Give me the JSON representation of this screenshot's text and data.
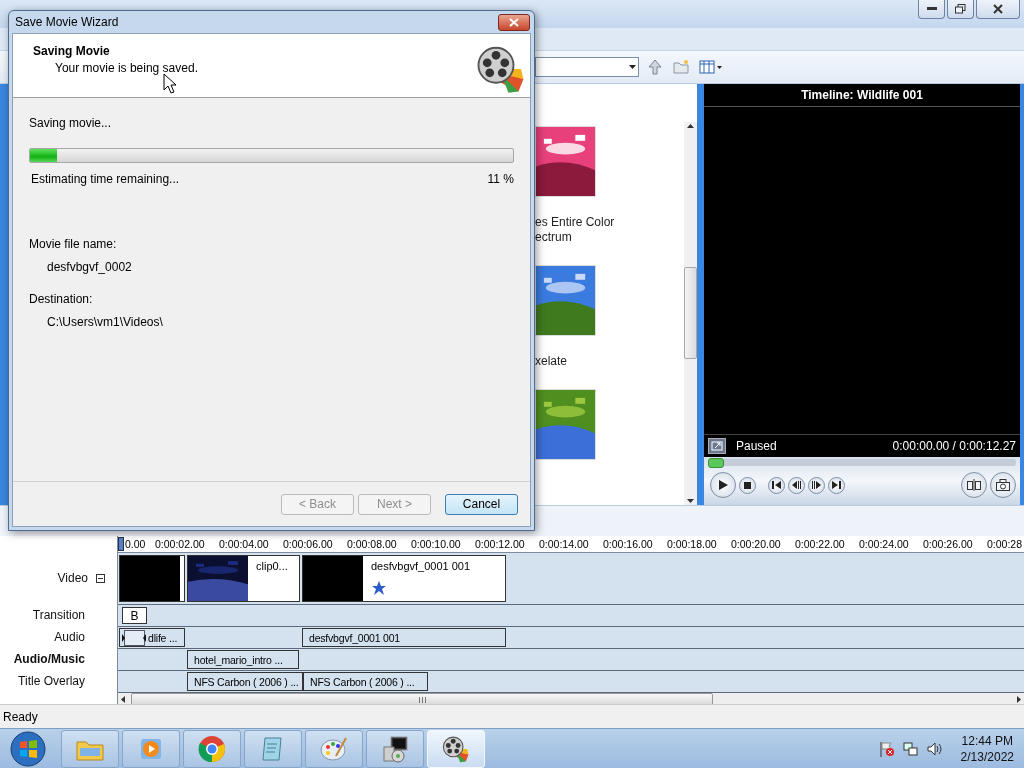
{
  "dialog": {
    "title": "Save Movie Wizard",
    "heading": "Saving Movie",
    "subheading": "Your movie is being saved.",
    "task": "Saving movie...",
    "progress": {
      "level": 0.055
    },
    "estimate": "Estimating time remaining...",
    "percent": "11 %",
    "fields": [
      {
        "label": "Movie file name:",
        "value": "desfvbgvf_0002"
      },
      {
        "label": "Destination:",
        "value": "C:\\Users\\vm1\\Videos\\"
      }
    ],
    "buttons": [
      {
        "label": "< Back",
        "disabled": true
      },
      {
        "label": "Next >",
        "disabled": true
      },
      {
        "label": "Cancel",
        "disabled": false
      }
    ]
  },
  "effects": [
    {
      "kind": "picture",
      "label": "es Entire Color ectrum"
    },
    {
      "kind": "picture",
      "label": "xelate"
    },
    {
      "kind": "picture"
    }
  ],
  "preview": {
    "title": "Timeline: Wildlife 001",
    "status": "Paused",
    "time": "0:00:00.00 / 0:00:12.27",
    "seek": {
      "level": 0
    }
  },
  "timeline": {
    "ruler": [
      "0.00",
      "0:00:02.00",
      "0:00:04.00",
      "0:00:06.00",
      "0:00:08.00",
      "0:00:10.00",
      "0:00:12.00",
      "0:00:14.00",
      "0:00:16.00",
      "0:00:18.00",
      "0:00:20.00",
      "0:00:22.00",
      "0:00:24.00",
      "0:00:26.00",
      "0:00:28"
    ],
    "tracks": [
      {
        "kind": "video",
        "label": "Video",
        "selected": false,
        "expanded": true,
        "clips": [
          {
            "kind": "black",
            "effect": false
          },
          {
            "kind": "picture",
            "label": "clip0...",
            "effect": false
          },
          {
            "kind": "black",
            "label": "desfvbgvf_0001 001",
            "effect": true
          }
        ]
      },
      {
        "kind": "transition",
        "label": "Transition",
        "selected": false,
        "clips": [
          {
            "label": "B"
          }
        ]
      },
      {
        "kind": "audio",
        "label": "Audio",
        "selected": false,
        "clips": [
          {
            "label": "dlife ...",
            "handle": true
          },
          {
            "label": "desfvbgvf_0001 001",
            "handle": false
          }
        ]
      },
      {
        "kind": "audio",
        "label": "Audio/Music",
        "selected": true,
        "clips": [
          {
            "label": "hotel_mario_intro ...",
            "handle": false
          }
        ]
      },
      {
        "kind": "audio",
        "label": "Title Overlay",
        "selected": false,
        "clips": [
          {
            "label": "NFS Carbon ( 2006 ) ...",
            "handle": false
          },
          {
            "label": "NFS Carbon ( 2006 ) ...",
            "handle": false
          }
        ]
      }
    ]
  },
  "status_bar": "Ready",
  "taskbar": {
    "apps": [
      {
        "kind": "explorer",
        "selected": false
      },
      {
        "kind": "media",
        "selected": false
      },
      {
        "kind": "browser",
        "selected": false
      },
      {
        "kind": "notepad",
        "selected": false
      },
      {
        "kind": "paint",
        "selected": false
      },
      {
        "kind": "setup",
        "selected": false
      },
      {
        "kind": "moviemaker",
        "selected": true
      }
    ],
    "clock": {
      "time": "12:44 PM",
      "date": "2/13/2022"
    }
  }
}
